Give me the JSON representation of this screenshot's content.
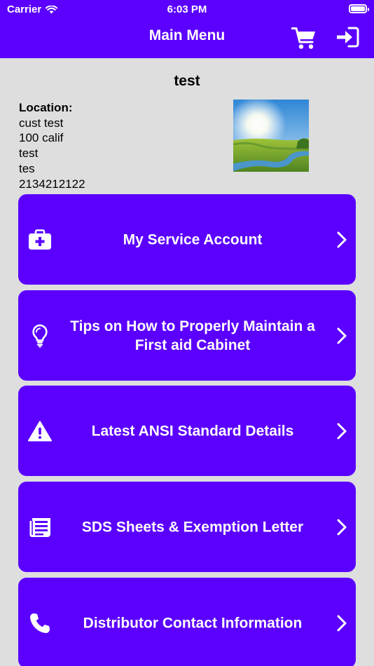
{
  "status_bar": {
    "carrier": "Carrier",
    "time": "6:03 PM"
  },
  "nav": {
    "title": "Main Menu"
  },
  "profile": {
    "name": "test",
    "location_heading": "Location:",
    "location_lines": [
      "cust test",
      "100 calif",
      "test",
      "tes",
      "2134212122"
    ]
  },
  "menu": [
    {
      "label": "My Service Account",
      "icon": "first-aid-kit-icon"
    },
    {
      "label": "Tips on How to Properly Maintain a First aid Cabinet",
      "icon": "lightbulb-icon"
    },
    {
      "label": "Latest ANSI Standard Details",
      "icon": "warning-icon"
    },
    {
      "label": "SDS Sheets & Exemption Letter",
      "icon": "document-list-icon"
    },
    {
      "label": "Distributor Contact Information",
      "icon": "phone-icon"
    }
  ],
  "colors": {
    "accent": "#5b00ff",
    "background": "#dedede",
    "text_on_accent": "#ffffff"
  }
}
